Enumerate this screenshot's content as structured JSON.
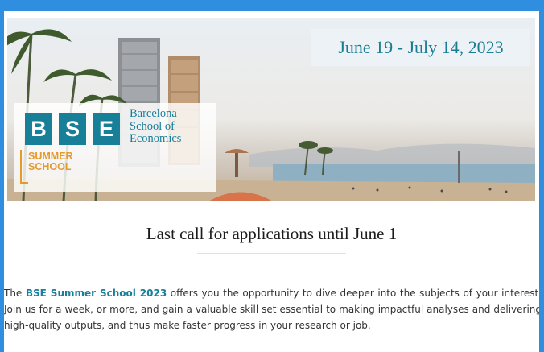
{
  "banner": {
    "dates": "June 19 - July 14, 2023",
    "logo": {
      "letters": [
        "B",
        "S",
        "E"
      ],
      "name_lines": [
        "Barcelona",
        "School of",
        "Economics"
      ],
      "summer_lines": [
        "SUMMER",
        "SCHOOL"
      ]
    }
  },
  "headline": "Last call for applications until June 1",
  "intro": {
    "prefix": "The ",
    "highlight": "BSE Summer School 2023",
    "rest": " offers you the opportunity to dive deeper into the subjects of your interest. Join us for a week, or more, and gain a valuable skill set essential to making impactful analyses and delivering high-quality outputs, and thus make faster progress in your research or job."
  },
  "colors": {
    "frame": "#2f8ee0",
    "brand_teal": "#187f99",
    "summer_orange": "#e59a2c"
  }
}
